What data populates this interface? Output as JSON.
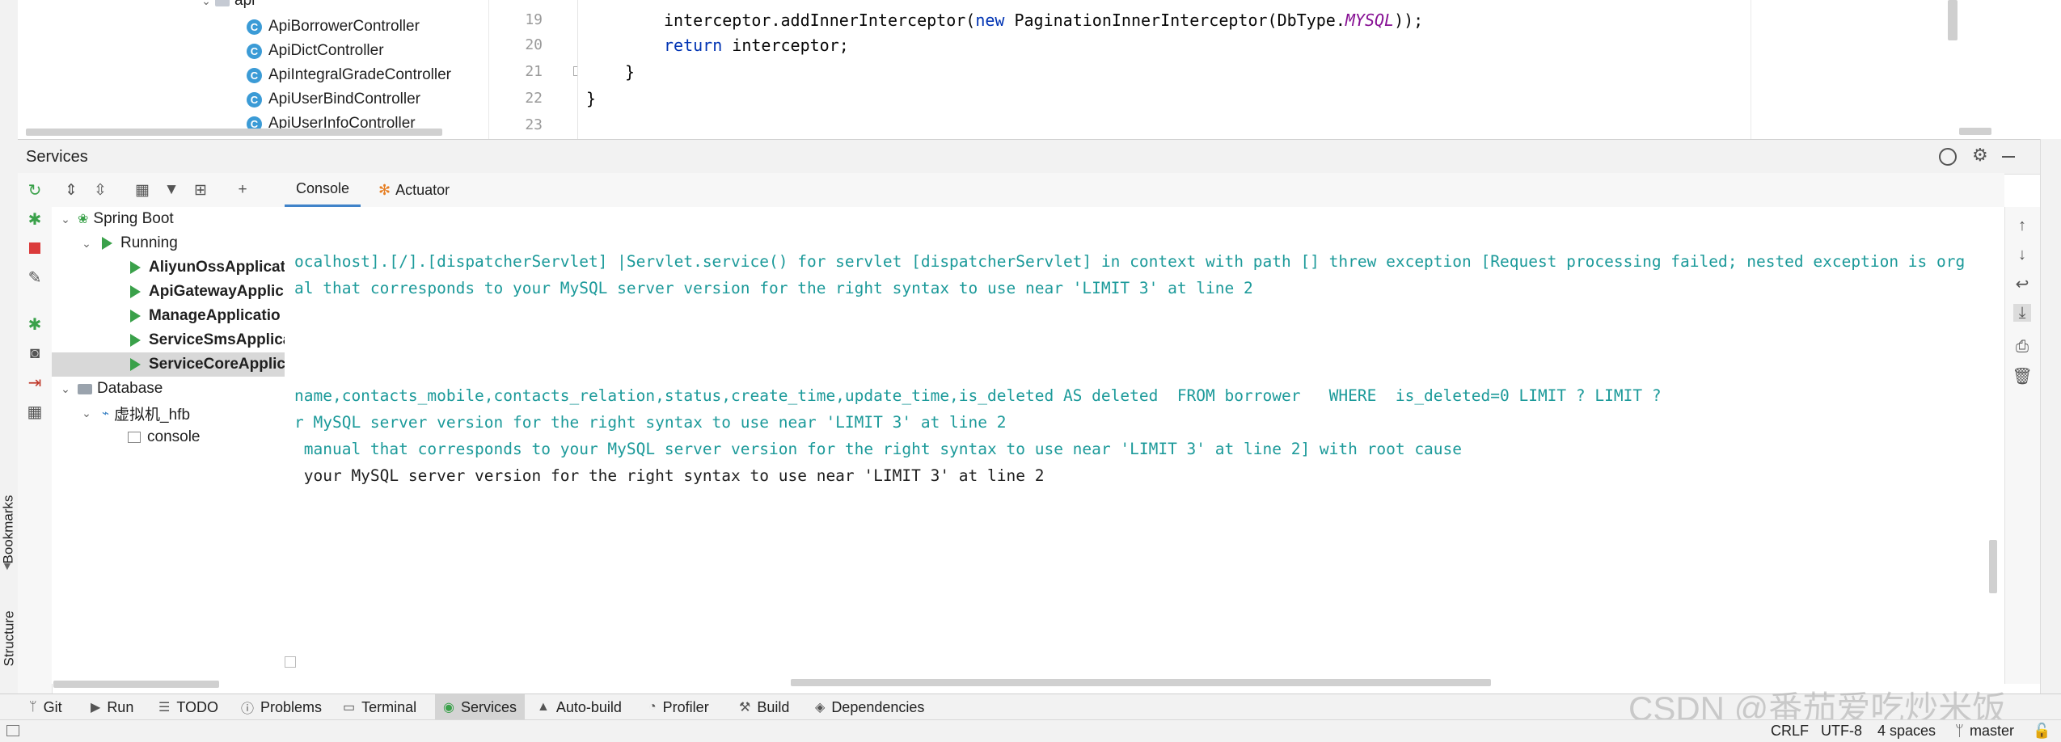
{
  "project_tree": {
    "folder_label": "api",
    "items": [
      "ApiBorrowerController",
      "ApiDictController",
      "ApiIntegralGradeController",
      "ApiUserBindController",
      "ApiUserInfoController"
    ]
  },
  "editor": {
    "lines": [
      {
        "number": "19",
        "code_parts": [
          "interceptor.addInnerInterceptor(",
          "new",
          " PaginationInnerInterceptor(DbType.",
          "MYSQL",
          "));"
        ]
      },
      {
        "number": "20",
        "code_parts": [
          "return",
          " interceptor;"
        ]
      },
      {
        "number": "21",
        "text": "}"
      },
      {
        "number": "22",
        "text": "}"
      },
      {
        "number": "23",
        "text": ""
      }
    ]
  },
  "services": {
    "title": "Services",
    "tabs": [
      "Console",
      "Actuator"
    ],
    "tree": {
      "spring_boot": "Spring Boot",
      "running": "Running",
      "apps": [
        "AliyunOssApplicat",
        "ApiGatewayApplic",
        "ManageApplicatio",
        "ServiceSmsApplica",
        "ServiceCoreApplica"
      ],
      "database": "Database",
      "datasource": "虚拟机_hfb",
      "console": "console"
    },
    "console_lines": [
      "ocalhost].[/].[dispatcherServlet] |Servlet.service() for servlet [dispatcherServlet] in context with path [] threw exception [Request processing failed; nested exception is org",
      "al that corresponds to your MySQL server version for the right syntax to use near 'LIMIT 3' at line 2",
      "name,contacts_mobile,contacts_relation,status,create_time,update_time,is_deleted AS deleted  FROM borrower   WHERE  is_deleted=0 LIMIT ? LIMIT ?",
      "r MySQL server version for the right syntax to use near 'LIMIT 3' at line 2",
      " manual that corresponds to your MySQL server version for the right syntax to use near 'LIMIT 3' at line 2] with root cause",
      " your MySQL server version for the right syntax to use near 'LIMIT 3' at line 2"
    ]
  },
  "left_strip": {
    "bookmarks": "Bookmarks",
    "structure": "Structure"
  },
  "bottom_tabs": [
    {
      "label": "Git",
      "icon": "git-branch-icon"
    },
    {
      "label": "Run",
      "icon": "run-icon"
    },
    {
      "label": "TODO",
      "icon": "list-icon"
    },
    {
      "label": "Problems",
      "icon": "info-icon"
    },
    {
      "label": "Terminal",
      "icon": "terminal-icon"
    },
    {
      "label": "Services",
      "icon": "services-icon"
    },
    {
      "label": "Auto-build",
      "icon": "warning-icon"
    },
    {
      "label": "Profiler",
      "icon": "profiler-icon"
    },
    {
      "label": "Build",
      "icon": "hammer-icon"
    },
    {
      "label": "Dependencies",
      "icon": "layers-icon"
    }
  ],
  "status_bar": {
    "line_sep": "CRLF",
    "encoding": "UTF-8",
    "indent": "4 spaces",
    "branch": "master",
    "watermark": "CSDN @番茄爱吃炒米饭"
  },
  "colors": {
    "accent": "#3aa14a",
    "console_text": "#1c9a9a",
    "keyword": "#0033b3"
  }
}
